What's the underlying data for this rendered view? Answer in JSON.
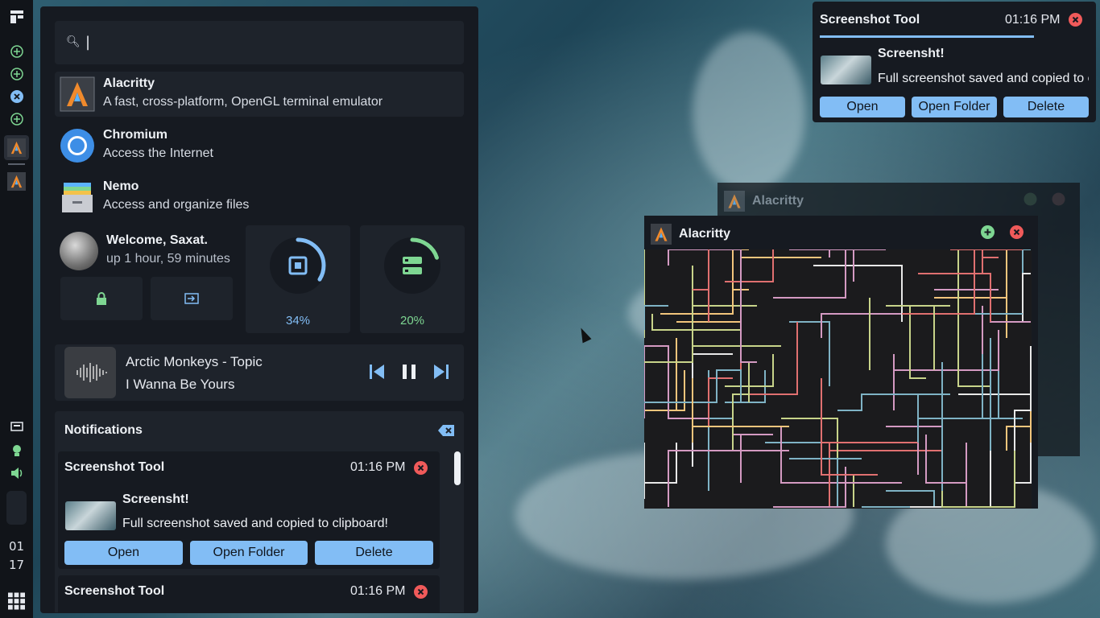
{
  "launcher": {
    "search": {
      "value": "|",
      "placeholder": ""
    },
    "apps": [
      {
        "name": "Alacritty",
        "description": "A fast, cross-platform, OpenGL terminal emulator"
      },
      {
        "name": "Chromium",
        "description": "Access the Internet"
      },
      {
        "name": "Nemo",
        "description": "Access and organize files"
      }
    ],
    "user": {
      "welcome": "Welcome, Saxat.",
      "uptime": "up 1 hour, 59 minutes"
    },
    "gauges": {
      "cpu_percent": "34%",
      "cpu_value": 0.34,
      "ram_percent": "20%",
      "ram_value": 0.2
    },
    "player": {
      "artist": "Arctic Monkeys - Topic",
      "track": "I Wanna Be Yours"
    },
    "notifications": {
      "title": "Notifications",
      "items": [
        {
          "app": "Screenshot Tool",
          "time": "01:16 PM",
          "heading": "Screensht!",
          "body": "Full screenshot saved and copied to clipboard!",
          "actions": [
            "Open",
            "Open Folder",
            "Delete"
          ]
        },
        {
          "app": "Screenshot Tool",
          "time": "01:16 PM"
        }
      ]
    }
  },
  "popup": {
    "app": "Screenshot Tool",
    "time": "01:16 PM",
    "heading": "Screensht!",
    "body": "Full screenshot saved and copied to clipboard!",
    "actions": [
      "Open",
      "Open Folder",
      "Delete"
    ]
  },
  "windows": {
    "back": {
      "title": "Alacritty"
    },
    "front": {
      "title": "Alacritty"
    }
  },
  "bar": {
    "clock_hour": "01",
    "clock_minute": "17"
  },
  "colors": {
    "accent": "#82bdf5",
    "green": "#7ed692",
    "red": "#f05a5a"
  }
}
